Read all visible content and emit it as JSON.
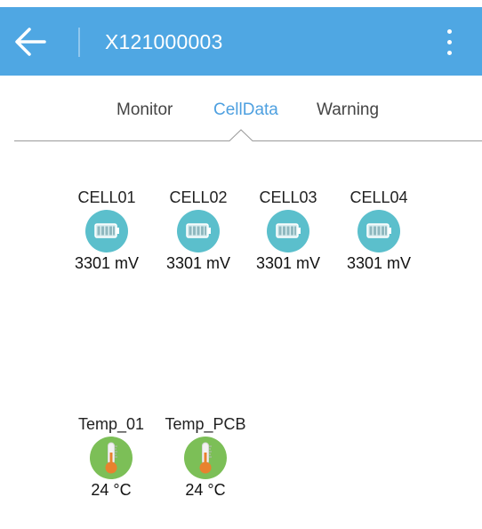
{
  "header": {
    "title": "X121000003",
    "back_icon": "arrow-left-icon",
    "menu_icon": "more-vert-icon",
    "color": "#4fa7e3"
  },
  "tabs": [
    {
      "label": "Monitor",
      "active": false
    },
    {
      "label": "CellData",
      "active": true
    },
    {
      "label": "Warning",
      "active": false
    }
  ],
  "cells": [
    {
      "label": "CELL01",
      "value": "3301 mV",
      "icon": "battery-icon"
    },
    {
      "label": "CELL02",
      "value": "3301 mV",
      "icon": "battery-icon"
    },
    {
      "label": "CELL03",
      "value": "3301 mV",
      "icon": "battery-icon"
    },
    {
      "label": "CELL04",
      "value": "3301 mV",
      "icon": "battery-icon"
    }
  ],
  "temps": [
    {
      "label": "Temp_01",
      "value": "24 °C",
      "icon": "thermometer-icon"
    },
    {
      "label": "Temp_PCB",
      "value": "24 °C",
      "icon": "thermometer-icon"
    }
  ],
  "colors": {
    "accent": "#4ea0e0",
    "battery_badge": "#5bbfcc",
    "temp_badge": "#7cbf57"
  }
}
